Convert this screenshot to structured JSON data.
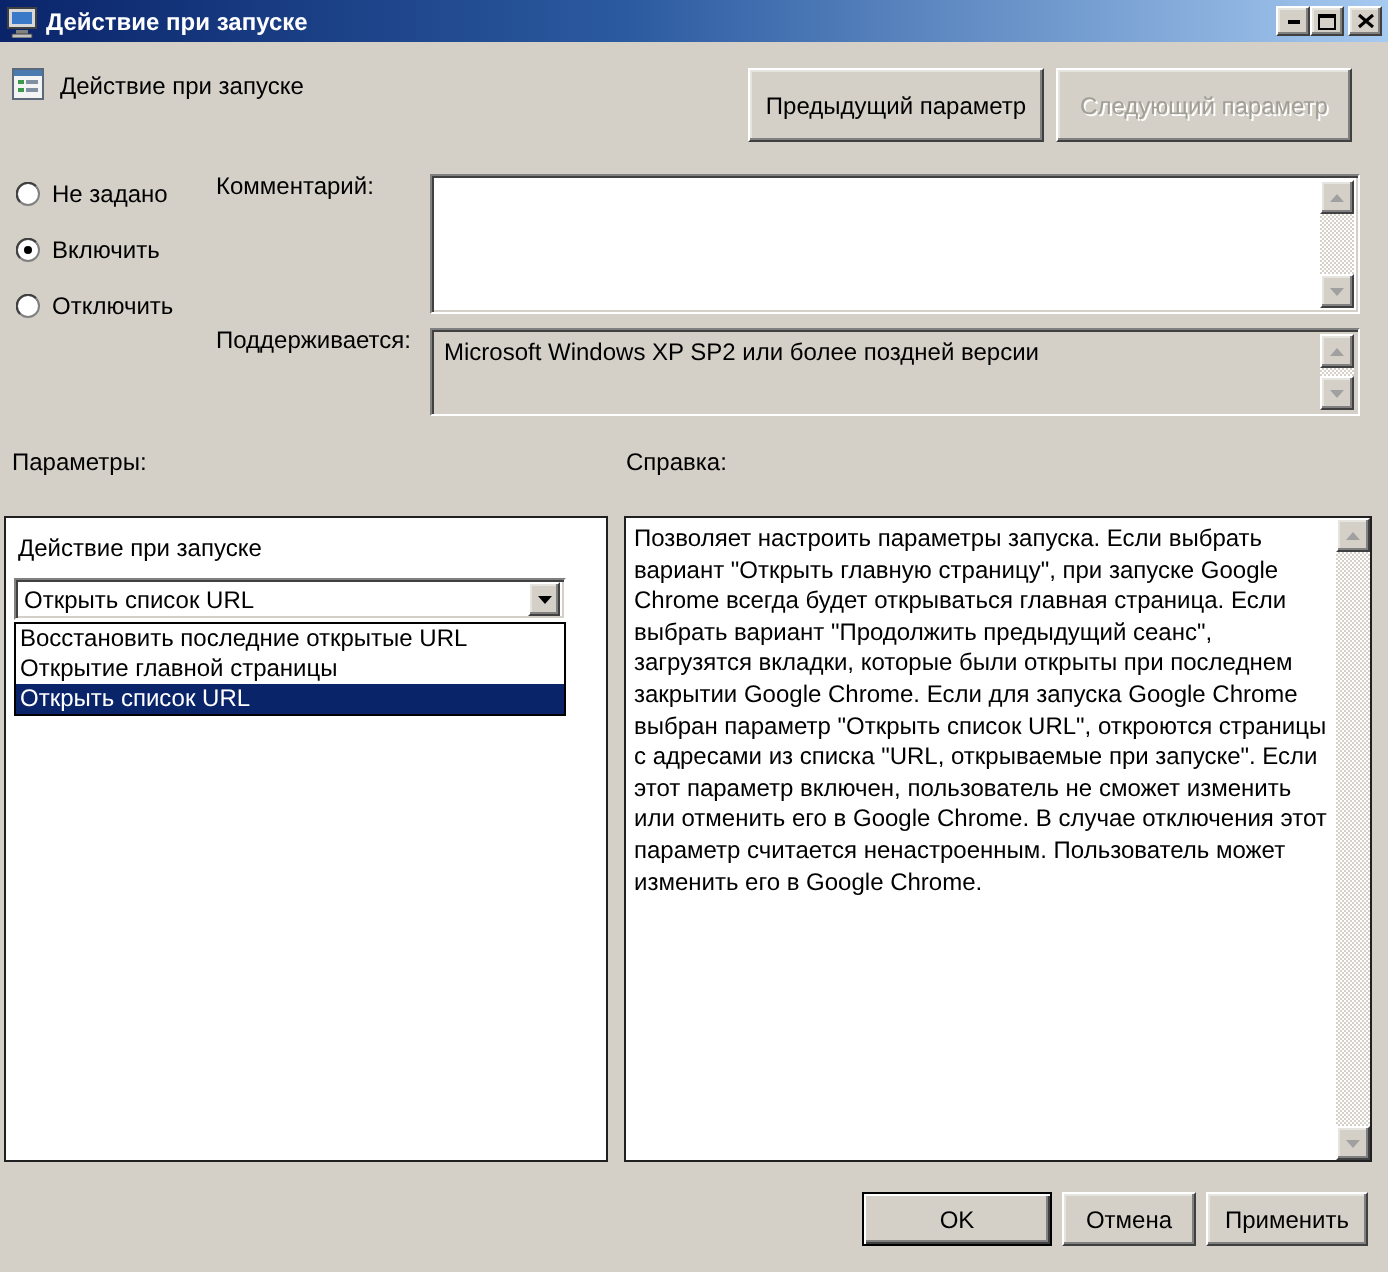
{
  "window": {
    "title": "Действие при запуске"
  },
  "policy": {
    "name": "Действие при запуске"
  },
  "nav_buttons": [
    {
      "label": "Предыдущий параметр",
      "disabled": false
    },
    {
      "label": "Следующий параметр",
      "disabled": true
    }
  ],
  "state_options": [
    {
      "label": "Не задано",
      "selected": false
    },
    {
      "label": "Включить",
      "selected": true
    },
    {
      "label": "Отключить",
      "selected": false
    }
  ],
  "comment": {
    "label": "Комментарий:"
  },
  "supported": {
    "label": "Поддерживается:",
    "value": "Microsoft Windows XP SP2 или более поздней версии"
  },
  "options": {
    "title": "Параметры:",
    "setting_label": "Действие при запуске",
    "combo": {
      "value": "Открыть список URL",
      "expanded": true,
      "items": [
        {
          "label": "Восстановить последние открытые URL",
          "selected": false
        },
        {
          "label": "Открытие главной страницы",
          "selected": false
        },
        {
          "label": "Открыть список URL",
          "selected": true
        }
      ]
    }
  },
  "help": {
    "title": "Справка:",
    "text": "Позволяет настроить параметры запуска. Если выбрать вариант \"Открыть главную страницу\", при запуске Google Chrome всегда будет открываться главная страница. Если выбрать вариант \"Продолжить предыдущий сеанс\", загрузятся вкладки, которые были открыты при последнем закрытии Google Chrome. Если для запуска Google Chrome выбран параметр \"Открыть список URL\", откроются страницы с адресами из списка \"URL, открываемые при запуске\". Если этот параметр включен, пользователь не сможет изменить или отменить его в Google Chrome. В случае отключения этот параметр считается ненастроенным. Пользователь может изменить его в Google Chrome."
  },
  "buttons": [
    {
      "label": "OK",
      "default": true
    },
    {
      "label": "Отмена",
      "default": false
    },
    {
      "label": "Применить",
      "default": false
    }
  ]
}
